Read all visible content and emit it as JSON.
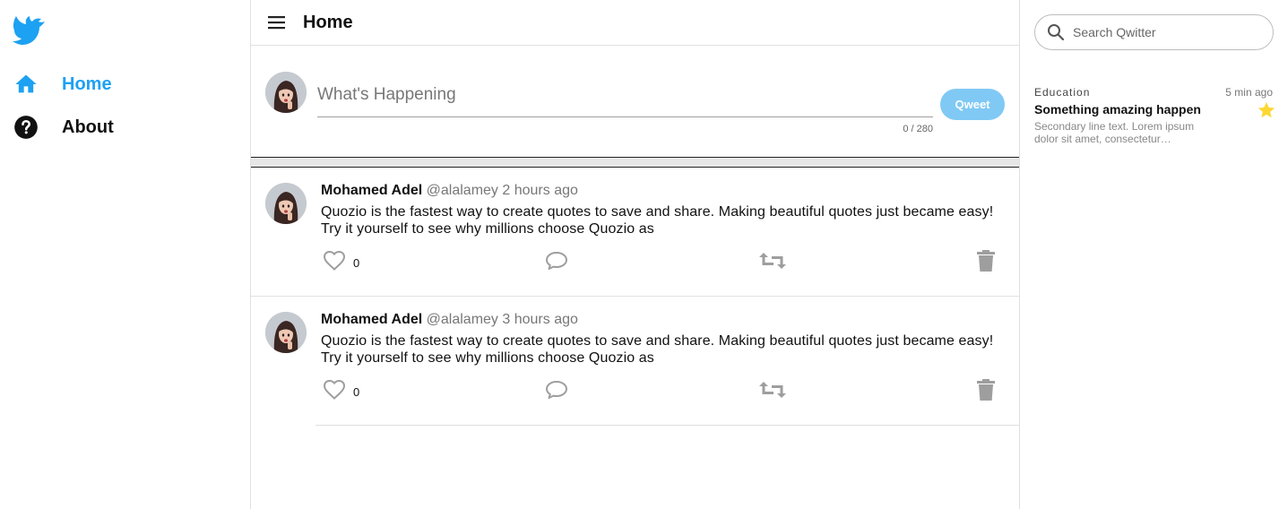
{
  "sidebar": {
    "logo_icon": "bird-icon",
    "items": [
      {
        "label": "Home",
        "icon": "home-icon",
        "active": true
      },
      {
        "label": "About",
        "icon": "help-circle-icon",
        "active": false
      }
    ]
  },
  "header": {
    "title": "Home",
    "menu_icon": "hamburger-menu-icon"
  },
  "composer": {
    "placeholder": "What's Happening",
    "value": "",
    "counter": "0 / 280",
    "button_label": "Qweet"
  },
  "tweets": [
    {
      "author": "Mohamed Adel",
      "handle": "@alalamey",
      "time": "2 hours ago",
      "text": "Quozio is the fastest way to create quotes to save and share. Making beautiful quotes just became easy! Try it yourself to see why millions choose Quozio as",
      "likes": "0"
    },
    {
      "author": "Mohamed Adel",
      "handle": "@alalamey",
      "time": "3 hours ago",
      "text": "Quozio is the fastest way to create quotes to save and share. Making beautiful quotes just became easy! Try it yourself to see why millions choose Quozio as",
      "likes": "0"
    }
  ],
  "search": {
    "placeholder": "Search Qwitter",
    "value": ""
  },
  "trends": [
    {
      "category": "Education",
      "time": "5 min ago",
      "title": "Something amazing happen",
      "secondary": "Secondary line text. Lorem ipsum dolor sit amet, consectetur…",
      "icon": "star-icon"
    }
  ],
  "colors": {
    "accent": "#1da1f2",
    "button": "#80c9f5",
    "star": "#fdd835",
    "icon_gray": "#9e9e9e"
  }
}
